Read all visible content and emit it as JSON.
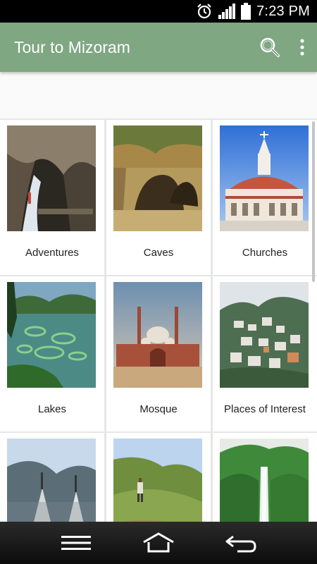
{
  "status_bar": {
    "time": "7:23 PM",
    "icons": [
      "alarm-clock-icon",
      "signal-strength-icon",
      "battery-icon"
    ]
  },
  "app_bar": {
    "title": "Tour to Mizoram",
    "actions": [
      "search-icon",
      "overflow-menu-icon"
    ]
  },
  "categories": [
    {
      "label": "Adventures"
    },
    {
      "label": "Caves"
    },
    {
      "label": "Churches"
    },
    {
      "label": "Lakes"
    },
    {
      "label": "Mosque"
    },
    {
      "label": "Places of Interest"
    },
    {
      "label": ""
    },
    {
      "label": ""
    },
    {
      "label": ""
    }
  ],
  "nav_bar": {
    "buttons": [
      "menu-icon",
      "home-icon",
      "back-icon"
    ]
  },
  "colors": {
    "app_bar": "#7ea782",
    "background": "#e6e6e6",
    "tile": "#ffffff"
  }
}
